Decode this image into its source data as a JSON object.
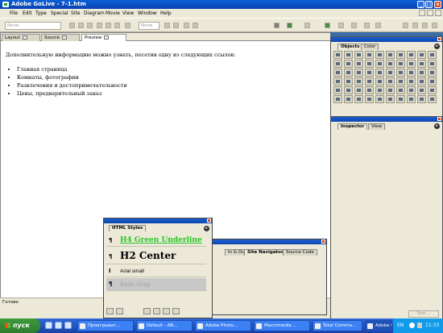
{
  "window": {
    "title": "Adobe GoLive - 7-1.htm",
    "buttons": {
      "minimize": "_",
      "maximize": "□",
      "close": "x"
    }
  },
  "menu": [
    "File",
    "Edit",
    "Type",
    "Special",
    "Site",
    "Diagram",
    "Movie",
    "View",
    "Window",
    "Help"
  ],
  "toolbar": {
    "format_select": "None",
    "size_select": "None"
  },
  "doc_tabs": [
    "Layout",
    "Source",
    "Preview"
  ],
  "content": {
    "intro": "Дополнительную информацию можно узнать, посетив одну из следующих ссылок:",
    "items": [
      "Главная страница",
      "Комнаты, фотографии",
      "Развлечения и достопримечательности",
      "Цены, предварительный заказ"
    ]
  },
  "status": "Готово",
  "objects_palette": {
    "tabs": [
      "Objects",
      "Color"
    ]
  },
  "inspector_palette": {
    "tabs": [
      "Inspector",
      "View"
    ]
  },
  "html_styles": {
    "title": "HTML Styles",
    "styles": [
      {
        "icon": "¶",
        "label": "H4 Green Underline"
      },
      {
        "icon": "¶",
        "label": "H2 Center"
      },
      {
        "icon": "I",
        "label": "Arial small"
      },
      {
        "icon": "¶",
        "label": "Italic Gray"
      }
    ]
  },
  "site_nav": {
    "tabs": [
      "In & Ou",
      "Site Navigator",
      "Source Code"
    ]
  },
  "sort_button": "Sort...",
  "taskbar": {
    "start": "пуск",
    "tasks": [
      "Проигрыват...",
      "Default - AB...",
      "Adobe Photo...",
      "Macromedia ...",
      "Total Comma...",
      "Adobe GoLive ..."
    ],
    "lang": "EN",
    "time": "11:33"
  }
}
